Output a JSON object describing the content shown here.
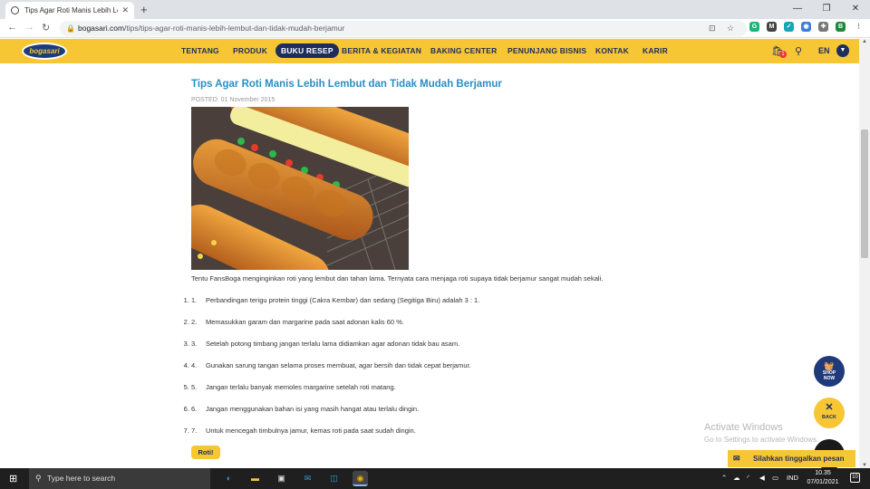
{
  "browser": {
    "tab_title": "Tips Agar Roti Manis Lebih Lemb",
    "url_host": "bogasari.com",
    "url_path": "/tips/tips-agar-roti-manis-lebih-lembut-dan-tidak-mudah-berjamur"
  },
  "site": {
    "logo_text": "bogasari",
    "nav": [
      "TENTANG",
      "PRODUK",
      "BUKU RESEP",
      "BERITA & KEGIATAN",
      "BAKING CENTER",
      "PENUNJANG BISNIS",
      "KONTAK",
      "KARIR"
    ],
    "active_nav": "BUKU RESEP",
    "cart_count": "1",
    "language": "EN"
  },
  "article": {
    "title": "Tips Agar Roti Manis Lebih Lembut dan Tidak Mudah Berjamur",
    "posted": "POSTED: 01 November 2015",
    "intro": "Tentu FansBoga menginginkan roti yang lembut dan tahan lama. Ternyata cara menjaga roti supaya tidak berjamur sangat mudah sekali.",
    "steps": [
      {
        "num": "1.",
        "text": "Perbandingan terigu protein tinggi (Cakra Kembar) dan sedang (Segitiga Biru) adalah 3 : 1."
      },
      {
        "num": "2.",
        "text": "Memasukkan garam dan margarine pada saat adonan kalis 60 %."
      },
      {
        "num": "3.",
        "text": "Setelah potong timbang jangan terlalu lama didiamkan agar adonan tidak bau asam."
      },
      {
        "num": "4.",
        "text": "Gunakan sarung tangan selama proses membuat, agar bersih dan tidak cepat berjamur."
      },
      {
        "num": "5.",
        "text": "Jangan terlalu banyak memoles margarine setelah roti matang."
      },
      {
        "num": "6.",
        "text": "Jangan menggunakan bahan isi yang masih hangat atau terlalu dingin."
      },
      {
        "num": "7.",
        "text": "Untuk mencegah timbulnya jamur, kemas roti pada saat sudah dingin."
      }
    ],
    "tag": "Roti!"
  },
  "floating": {
    "shop_line1": "SHOP",
    "shop_line2": "NOW",
    "back_label": "BACK",
    "chat_label": "Silahkan tinggalkan pesan"
  },
  "watermark": {
    "line1": "Activate Windows",
    "line2": "Go to Settings to activate Windows."
  },
  "taskbar": {
    "search_placeholder": "Type here to search",
    "language": "IND",
    "time": "10.35",
    "date": "07/01/2021",
    "notification_count": "10"
  }
}
